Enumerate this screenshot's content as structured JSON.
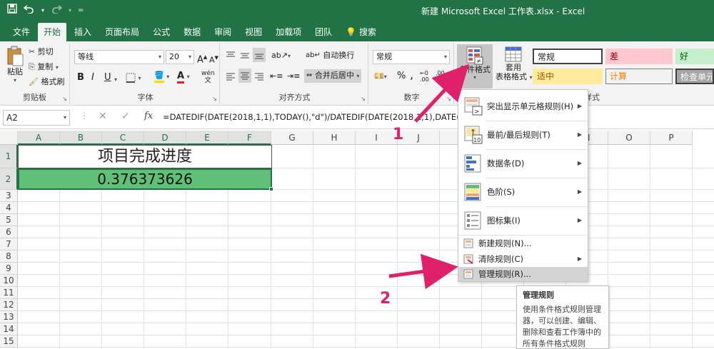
{
  "window": {
    "title": "新建 Microsoft Excel 工作表.xlsx  -  Excel"
  },
  "quick_access": {
    "save_icon": "save-icon",
    "undo_icon": "undo-icon",
    "redo_icon": "redo-icon",
    "customize_icon": "customize-icon"
  },
  "tabs": [
    "文件",
    "开始",
    "插入",
    "页面布局",
    "公式",
    "数据",
    "审阅",
    "视图",
    "加载项",
    "团队",
    "搜索"
  ],
  "active_tab": "开始",
  "ribbon": {
    "clipboard": {
      "paste": "粘贴",
      "cut": "剪切",
      "copy": "复制",
      "format_painter": "格式刷",
      "label": "剪贴板"
    },
    "font": {
      "name": "等线",
      "size": "20",
      "grow": "A",
      "shrink": "A",
      "bold": "B",
      "italic": "I",
      "underline": "U",
      "font_color": "A",
      "wen": "wén",
      "label": "字体"
    },
    "alignment": {
      "wrap": "自动换行",
      "merge": "合并后居中",
      "label": "对齐方式"
    },
    "number": {
      "format": "常规",
      "percent": "%",
      "comma": ",",
      "label": "数字"
    },
    "conditional_format": {
      "label": "条件格式"
    },
    "table_format": {
      "label1": "套用",
      "label2": "表格格式"
    },
    "styles": {
      "normal": "常规",
      "bad": "差",
      "good": "好",
      "neutral": "适中",
      "calc": "计算",
      "check": "检查单元",
      "label": "样式"
    }
  },
  "formula_bar": {
    "namebox": "A2",
    "fx": "fx",
    "formula": "=DATEDIF(DATE(2018,1,1),TODAY(),\"d\")/DATEDIF(DATE(2018,1,1),DATE(201"
  },
  "grid": {
    "columns": [
      "A",
      "B",
      "C",
      "D",
      "E",
      "F",
      "G",
      "H",
      "I",
      "J",
      "K",
      "L",
      "M",
      "N",
      "O",
      "P"
    ],
    "rows": [
      "1",
      "2",
      "3",
      "4",
      "5",
      "6",
      "7",
      "8",
      "9",
      "10",
      "11",
      "12",
      "13",
      "14",
      "15"
    ],
    "cell_a1": "项目完成进度",
    "cell_a2": "0.376373626"
  },
  "menu": {
    "items": [
      {
        "label": "突出显示单元格规则(H)",
        "has_arrow": true
      },
      {
        "label": "最前/最后规则(T)",
        "has_arrow": true
      },
      {
        "label": "数据条(D)",
        "has_arrow": true
      },
      {
        "label": "色阶(S)",
        "has_arrow": true
      },
      {
        "label": "图标集(I)",
        "has_arrow": true
      },
      {
        "label": "新建规则(N)...",
        "has_arrow": false
      },
      {
        "label": "清除规则(C)",
        "has_arrow": true
      },
      {
        "label": "管理规则(R)...",
        "has_arrow": false
      }
    ]
  },
  "tooltip": {
    "title": "管理规则",
    "body": "使用条件格式规则管理器，可以创建、编辑、删除和查看工作簿中的所有条件格式规则"
  },
  "annotations": {
    "one": "1",
    "two": "2"
  },
  "colors": {
    "accent": "#217346",
    "cell_fill": "#5fc077",
    "arrow": "#e0206a",
    "bad_fill": "#ffc7ce",
    "good_fill": "#c6efce",
    "neutral_fill": "#ffeb9c",
    "calc_fill": "#f2f2f2",
    "check_fill": "#a5a5a5"
  }
}
